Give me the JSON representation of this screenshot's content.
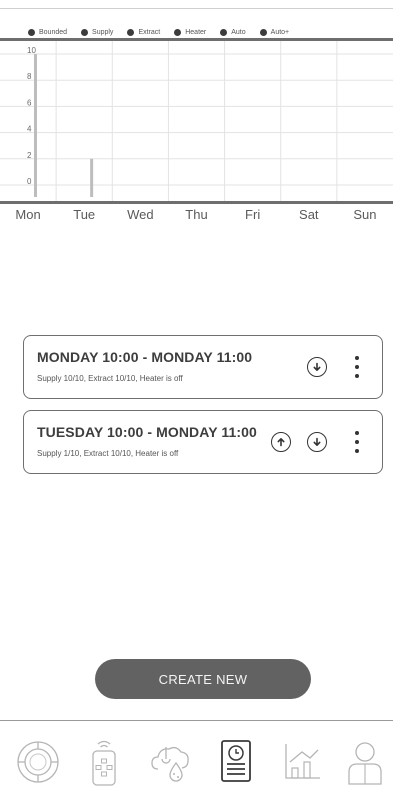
{
  "legend": {
    "items": [
      {
        "label": "Bounded"
      },
      {
        "label": "Supply"
      },
      {
        "label": "Extract"
      },
      {
        "label": "Heater"
      },
      {
        "label": "Auto"
      },
      {
        "label": "Auto+"
      }
    ]
  },
  "chart_data": {
    "type": "bar",
    "categories": [
      "Mon",
      "Tue",
      "Wed",
      "Thu",
      "Fri",
      "Sat",
      "Sun"
    ],
    "series": [
      {
        "values": [
          10,
          2,
          0,
          0,
          0,
          0,
          0
        ]
      }
    ],
    "ylim": [
      0,
      10
    ],
    "y_ticks": [
      0,
      2,
      4,
      6,
      8,
      10
    ],
    "grid": true,
    "legend": "top"
  },
  "schedules": [
    {
      "title": "MONDAY 10:00 - MONDAY 11:00",
      "subtitle": "Supply 10/10, Extract 10/10, Heater is off",
      "has_up": false,
      "has_down": true
    },
    {
      "title": "TUESDAY 10:00 - MONDAY 11:00",
      "subtitle": "Supply 1/10, Extract 10/10, Heater is off",
      "has_up": true,
      "has_down": true
    }
  ],
  "create_button": {
    "label": "CREATE NEW"
  },
  "nav": {
    "items": [
      {
        "icon": "dial-icon"
      },
      {
        "icon": "remote-control-icon"
      },
      {
        "icon": "weather-humidity-icon"
      },
      {
        "icon": "schedule-icon",
        "active": true
      },
      {
        "icon": "statistics-icon"
      },
      {
        "icon": "user-profile-icon"
      }
    ]
  },
  "colors": {
    "accent": "#626262",
    "bar": "#bdbdbd",
    "grid": "#e3e3e3"
  }
}
